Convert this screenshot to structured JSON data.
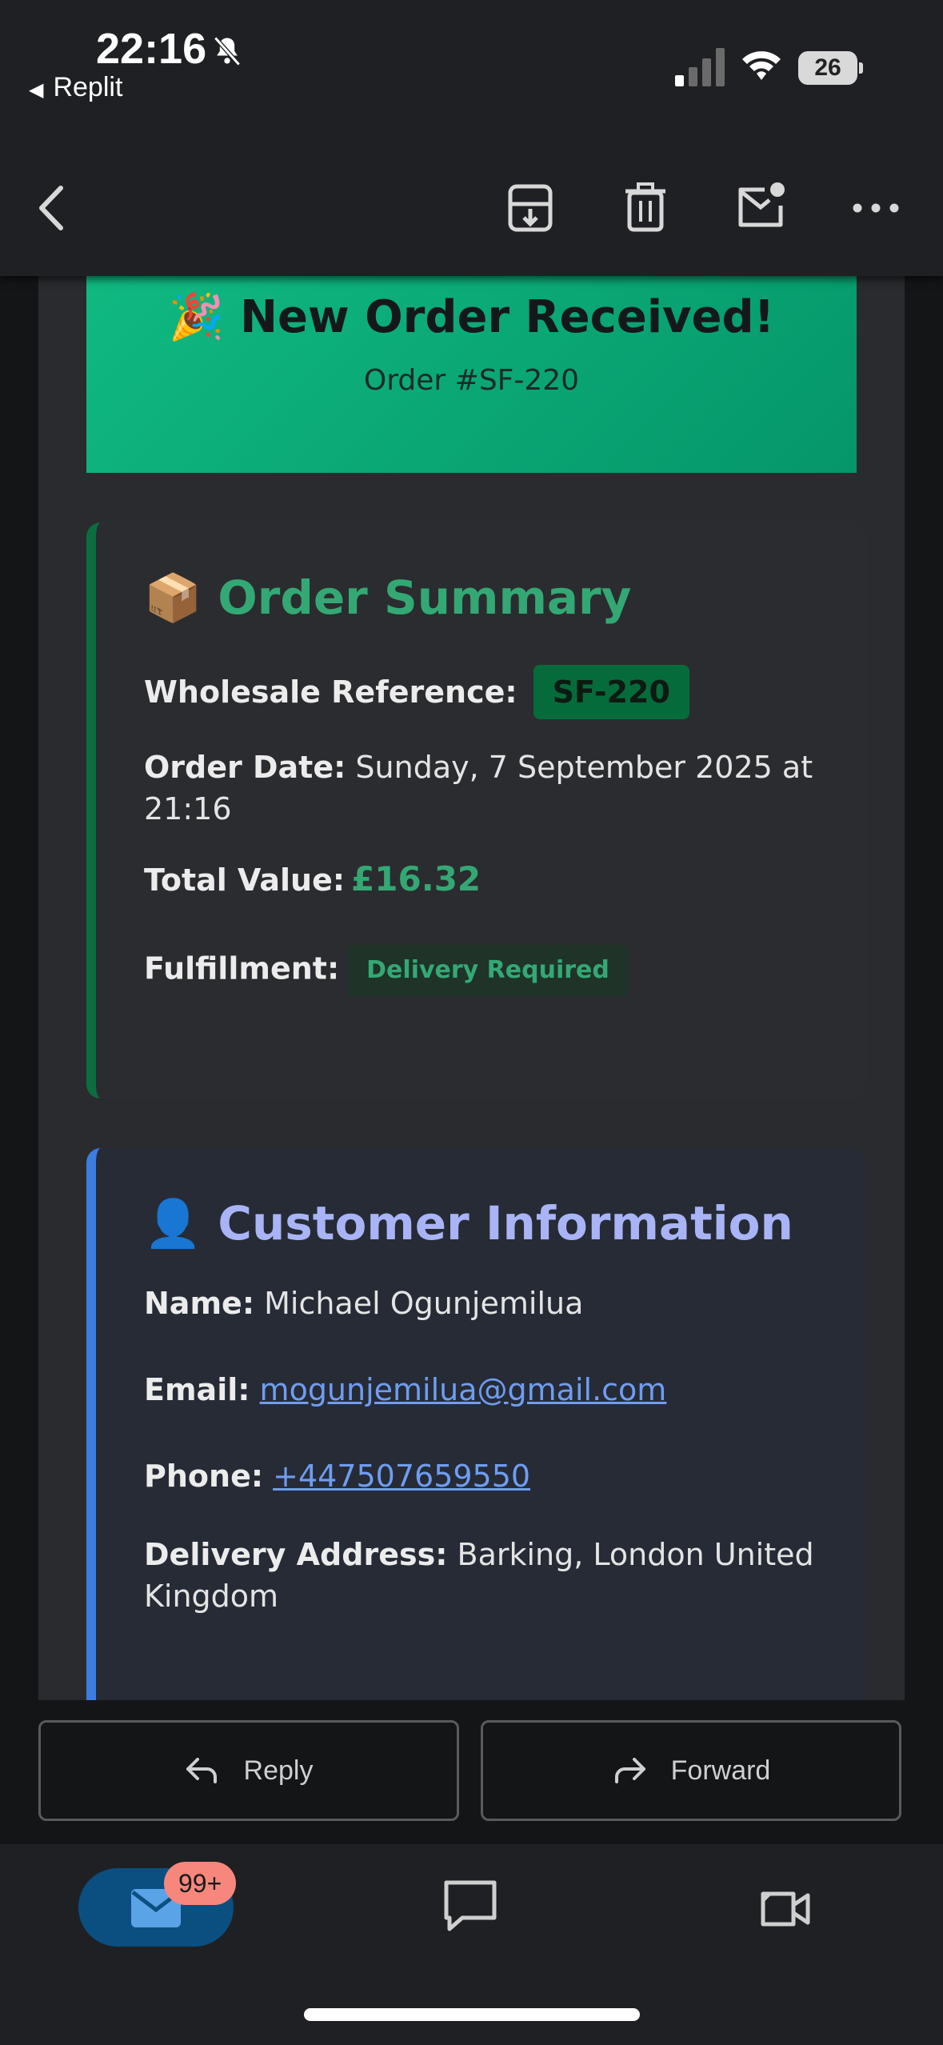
{
  "status_bar": {
    "time": "22:16",
    "back_app": "Replit",
    "battery": "26"
  },
  "toolbar": {
    "icons": [
      "back-chevron-icon",
      "archive-icon",
      "trash-icon",
      "mark-unread-icon",
      "more-icon"
    ]
  },
  "email": {
    "banner": {
      "emoji": "🎉",
      "title": "New Order Received!",
      "subtitle": "Order #SF-220"
    },
    "summary": {
      "emoji": "📦",
      "heading": "Order Summary",
      "ref_label": "Wholesale Reference:",
      "ref_value": "SF-220",
      "date_label": "Order Date:",
      "date_value": "Sunday, 7 September 2025 at 21:16",
      "total_label": "Total Value:",
      "total_value": "£16.32",
      "fulfil_label": "Fulfillment:",
      "fulfil_value": "Delivery Required"
    },
    "customer": {
      "emoji": "👤",
      "heading": "Customer Information",
      "name_label": "Name:",
      "name_value": "Michael Ogunjemilua",
      "email_label": "Email:",
      "email_value": "mogunjemilua@gmail.com",
      "phone_label": "Phone:",
      "phone_value": "+447507659550",
      "address_label": "Delivery Address:",
      "address_value": "Barking, London United Kingdom"
    }
  },
  "actions": {
    "reply": "Reply",
    "forward": "Forward"
  },
  "tabbar": {
    "mail_badge": "99+"
  },
  "colors": {
    "banner_start": "#10b981",
    "banner_end": "#059669",
    "summary_accent": "#34a874",
    "customer_accent": "#a8b4f5",
    "link": "#6f9df0",
    "mail_tab": "#0a4f80",
    "badge": "#f7877c"
  }
}
